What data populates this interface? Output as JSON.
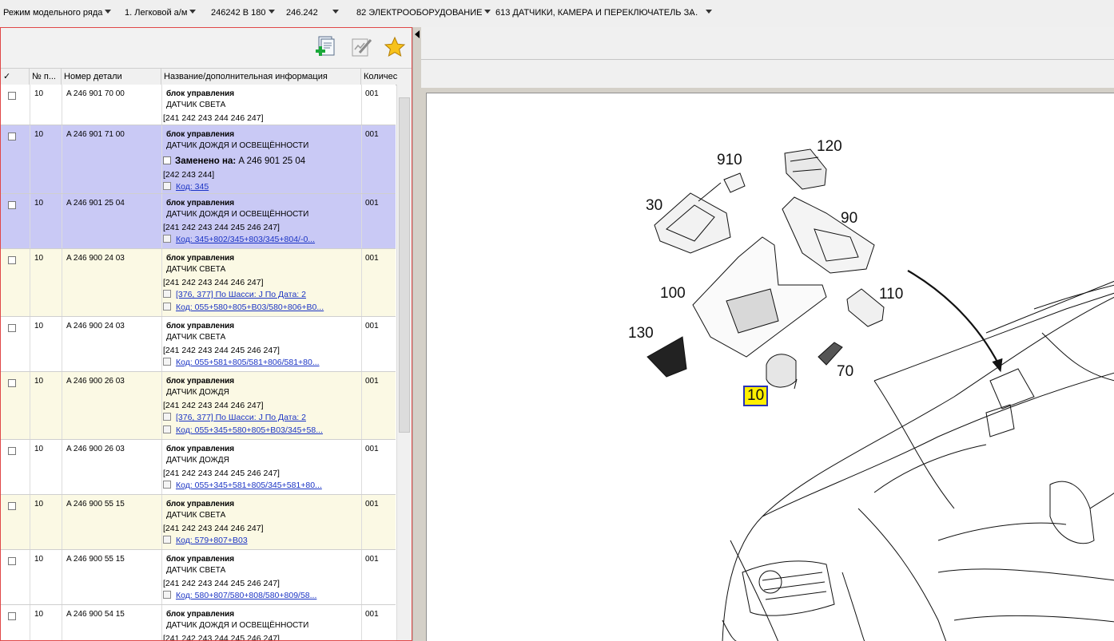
{
  "breadcrumb": [
    {
      "label": "Режим модельного ряда",
      "dropdown": true
    },
    {
      "label": "1. Легковой а/м",
      "dropdown": true
    },
    {
      "label": "246242 В 180",
      "dropdown": true
    },
    {
      "label": "246.242",
      "dropdown": true
    },
    {
      "label": "82 ЭЛЕКТРООБОРУДОВАНИЕ",
      "dropdown": true
    },
    {
      "label": "613 ДАТЧИКИ, КАМЕРА И ПЕРЕКЛЮЧАТЕЛЬ ЗА",
      "dropdown": false
    },
    {
      "label": "...",
      "dropdown": true
    }
  ],
  "toolbar": {
    "icons": [
      "add-to-list-icon",
      "edit-notes-icon",
      "favorites-star-icon"
    ]
  },
  "table": {
    "columns": [
      "✓",
      "№ п...",
      "Номер детали",
      "Название/дополнительная информация",
      "Количес"
    ],
    "rows": [
      {
        "pos": "10",
        "part": "A 246 901 70 00",
        "name": "блок управления",
        "desc": "ДАТЧИК СВЕТА",
        "variants": "[241 242 243 244 246 247]",
        "replaced": "",
        "links": [],
        "qty": "001",
        "bg": "white"
      },
      {
        "pos": "10",
        "part": "A 246 901 71 00",
        "name": "блок управления",
        "desc": "ДАТЧИК ДОЖДЯ И ОСВЕЩЁННОСТИ",
        "replaced": "Заменено на:",
        "replaced_part": " A 246 901 25 04",
        "variants": "[242 243 244]",
        "links": [
          "Код: 345"
        ],
        "qty": "001",
        "bg": "blue"
      },
      {
        "pos": "10",
        "part": "A 246 901 25 04",
        "name": "блок управления",
        "desc": "ДАТЧИК ДОЖДЯ И ОСВЕЩЁННОСТИ",
        "variants": "[241 242 243 244 245 246 247]",
        "replaced": "",
        "links": [
          "Код: 345+802/345+803/345+804/-0..."
        ],
        "qty": "001",
        "bg": "blue"
      },
      {
        "pos": "10",
        "part": "A 246 900 24 03",
        "name": "блок управления",
        "desc": "ДАТЧИК СВЕТА",
        "variants": "[241 242 243 244 246 247]",
        "replaced": "",
        "links": [
          "[376, 377] По Шасси: J По Дата: 2",
          "Код: 055+580+805+B03/580+806+B0..."
        ],
        "qty": "001",
        "bg": "yellow"
      },
      {
        "pos": "10",
        "part": "A 246 900 24 03",
        "name": "блок управления",
        "desc": "ДАТЧИК СВЕТА",
        "variants": "[241 242 243 244 245 246 247]",
        "replaced": "",
        "links": [
          "Код: 055+581+805/581+806/581+80..."
        ],
        "qty": "001",
        "bg": "white"
      },
      {
        "pos": "10",
        "part": "A 246 900 26 03",
        "name": "блок управления",
        "desc": "ДАТЧИК ДОЖДЯ",
        "variants": "[241 242 243 244 246 247]",
        "replaced": "",
        "links": [
          "[376, 377] По Шасси: J По Дата: 2",
          "Код: 055+345+580+805+B03/345+58..."
        ],
        "qty": "001",
        "bg": "yellow"
      },
      {
        "pos": "10",
        "part": "A 246 900 26 03",
        "name": "блок управления",
        "desc": "ДАТЧИК ДОЖДЯ",
        "variants": "[241 242 243 244 245 246 247]",
        "replaced": "",
        "links": [
          "Код: 055+345+581+805/345+581+80..."
        ],
        "qty": "001",
        "bg": "white"
      },
      {
        "pos": "10",
        "part": "A 246 900 55 15",
        "name": "блок управления",
        "desc": "ДАТЧИК СВЕТА",
        "variants": "[241 242 243 244 246 247]",
        "replaced": "",
        "links": [
          "Код: 579+807+B03"
        ],
        "qty": "001",
        "bg": "yellow"
      },
      {
        "pos": "10",
        "part": "A 246 900 55 15",
        "name": "блок управления",
        "desc": "ДАТЧИК СВЕТА",
        "variants": "[241 242 243 244 245 246 247]",
        "replaced": "",
        "links": [
          "Код: 580+807/580+808/580+809/58..."
        ],
        "qty": "001",
        "bg": "white"
      },
      {
        "pos": "10",
        "part": "A 246 900 54 15",
        "name": "блок управления",
        "desc": "ДАТЧИК ДОЖДЯ И ОСВЕЩЁННОСТИ",
        "variants": "[241 242 243 244 245 246 247]",
        "replaced": "",
        "links": [],
        "qty": "001",
        "bg": "white"
      }
    ]
  },
  "diagram": {
    "callouts": [
      "910",
      "120",
      "30",
      "90",
      "100",
      "110",
      "130",
      "70",
      "10"
    ],
    "selected": "10"
  },
  "colors": {
    "row_selected": "#c9c9f5",
    "row_highlight": "#fbf9e4",
    "link": "#1a33c4",
    "callout_selected_bg": "#ffef00",
    "callout_selected_border": "#2832b8",
    "panel_border": "#e04848"
  }
}
